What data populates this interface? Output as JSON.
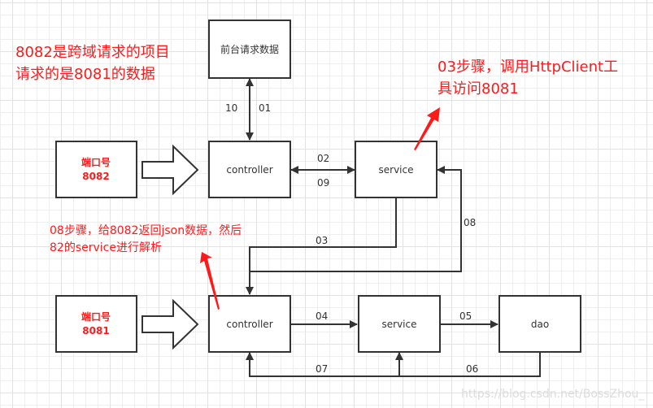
{
  "colors": {
    "annotation": "#ff1a1a",
    "stroke": "#333333",
    "background": "#ffffff",
    "grid": "#e2e2e2"
  },
  "notes": [
    {
      "line1": "8082是跨域请求的项目",
      "line2": "请求的是8081的数据"
    },
    {
      "line1": "03步骤，调用HttpClient工",
      "line2": "具访问8081"
    },
    {
      "line1": "08步骤，给8082返回json数据，然后",
      "line2": "82的service进行解析"
    }
  ],
  "nodes": {
    "frontend": "前台请求数据",
    "port8082": {
      "title": "端口号",
      "port": "8082"
    },
    "port8081": {
      "title": "端口号",
      "port": "8081"
    },
    "controller_top": "controller",
    "service_top": "service",
    "controller_bottom": "controller",
    "service_bottom": "service",
    "dao": "dao"
  },
  "edges": {
    "e10": "10",
    "e01": "01",
    "e02": "02",
    "e09": "09",
    "e03": "03",
    "e08": "08",
    "e04": "04",
    "e05": "05",
    "e06": "06",
    "e07": "07"
  },
  "watermark": "https://blog.csdn.net/BossZhou_"
}
